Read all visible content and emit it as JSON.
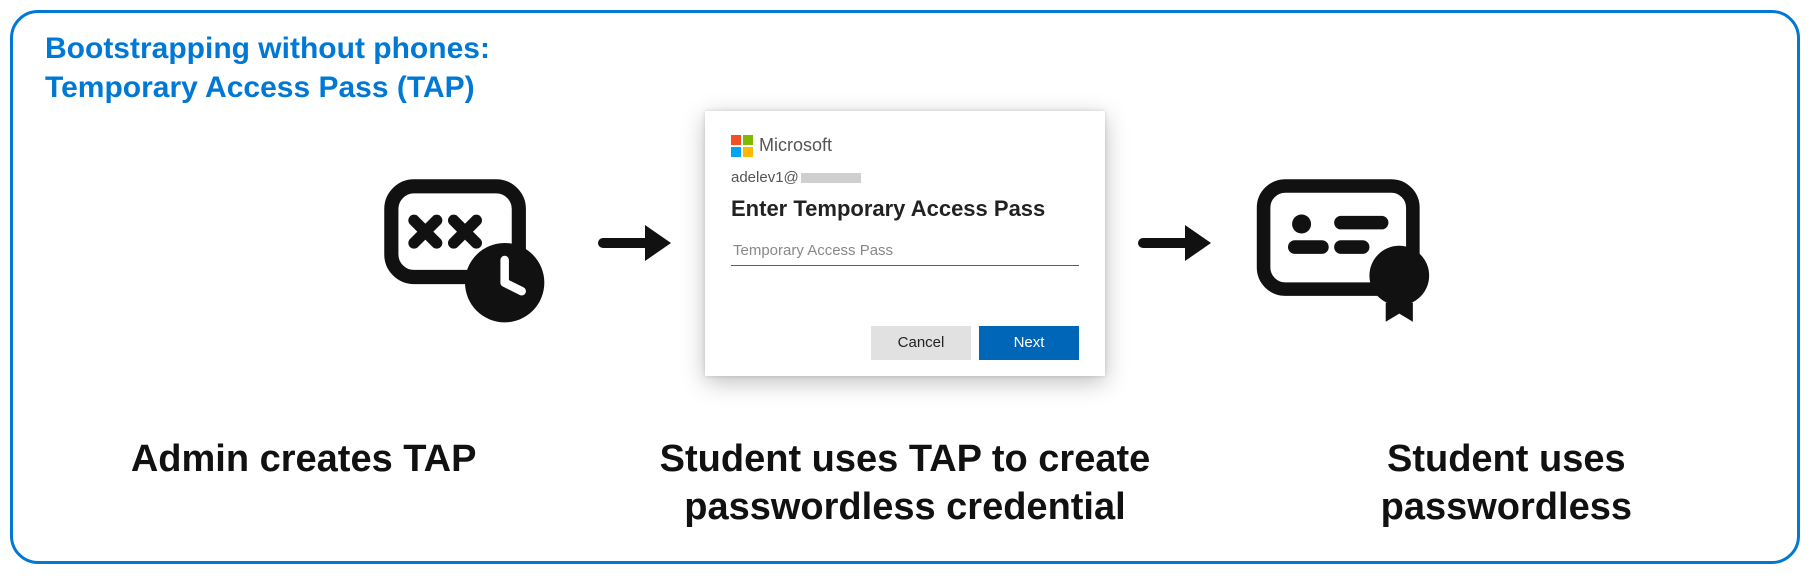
{
  "title_line1": "Bootstrapping without phones:",
  "title_line2": "Temporary Access Pass (TAP)",
  "step1_caption": "Admin creates TAP",
  "step2_caption_l1": "Student uses TAP to create",
  "step2_caption_l2": "passwordless credential",
  "step3_caption_l1": "Student uses",
  "step3_caption_l2": "passwordless",
  "dialog": {
    "brand": "Microsoft",
    "account_prefix": "adelev1@",
    "heading": "Enter Temporary Access Pass",
    "placeholder": "Temporary Access Pass",
    "cancel": "Cancel",
    "next": "Next"
  },
  "icons": {
    "tap_clock": "password-clock-icon",
    "arrow": "arrow-right-icon",
    "badge": "credential-badge-icon"
  }
}
